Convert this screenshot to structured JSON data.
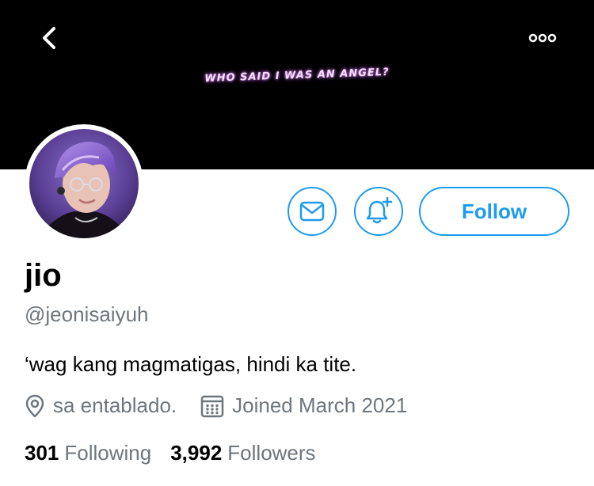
{
  "header": {
    "banner_text": "WHO SAID I WAS AN ANGEL?",
    "back_icon": "chevron-left-icon",
    "more_icon": "more-horizontal-icon"
  },
  "profile": {
    "display_name": "jio",
    "handle": "@jeonisaiyuh",
    "bio": "‘wag kang magmatigas, hindi ka tite.",
    "location": "sa entablado.",
    "joined": "Joined March 2021",
    "following_count": "301",
    "following_label": "Following",
    "followers_count": "3,992",
    "followers_label": "Followers"
  },
  "actions": {
    "message_icon": "mail-icon",
    "notify_icon": "bell-plus-icon",
    "follow_label": "Follow"
  },
  "colors": {
    "accent": "#1d9bf0",
    "secondary_text": "#6e767d",
    "banner_bg": "#000000"
  }
}
